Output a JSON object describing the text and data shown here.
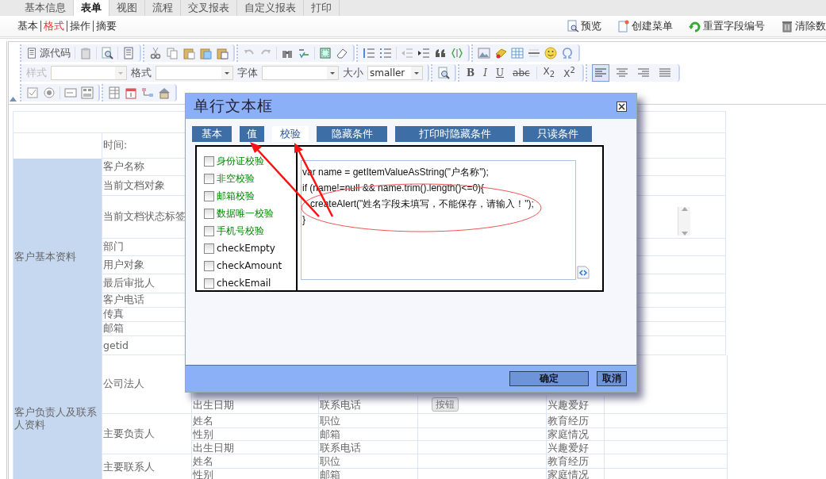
{
  "top_tabs": [
    {
      "label": "基本信息",
      "selected": false
    },
    {
      "label": "表单",
      "selected": true
    },
    {
      "label": "视图",
      "selected": false
    },
    {
      "label": "流程",
      "selected": false
    },
    {
      "label": "交叉报表",
      "selected": false
    },
    {
      "label": "自定义报表",
      "selected": false
    },
    {
      "label": "打印",
      "selected": false
    }
  ],
  "sub_tabs": [
    {
      "label": "基本",
      "selected": false
    },
    {
      "label": "格式",
      "selected": true
    },
    {
      "label": "操作",
      "selected": false
    },
    {
      "label": "摘要",
      "selected": false
    }
  ],
  "actions": [
    {
      "label": "预览"
    },
    {
      "label": "创建菜单"
    },
    {
      "label": "重置字段编号"
    },
    {
      "label": "清除数"
    }
  ],
  "editor_toolbar": {
    "source_button": "源代码",
    "dropdowns": [
      {
        "label": "样式",
        "disabled": true
      },
      {
        "label": "格式",
        "disabled": false
      },
      {
        "label": "字体",
        "disabled": false
      },
      {
        "label": "大小",
        "disabled": false,
        "value": "smaller"
      }
    ],
    "format_buttons": [
      "B",
      "I",
      "U",
      "abc",
      "X$_{2}$",
      "X$^{2}$"
    ],
    "alignments": [
      {
        "selected": true
      },
      {
        "selected": false
      },
      {
        "selected": false
      },
      {
        "selected": false
      }
    ]
  },
  "form_table": {
    "groups": [
      {
        "fields": [
          {
            "label": "时间:"
          }
        ]
      },
      {
        "label": "客户基本资料",
        "fields": [
          {
            "label": "客户名称"
          },
          {
            "label": "当前文档对象"
          },
          {
            "label": "当前文档状态标签"
          },
          {
            "label": "部门"
          },
          {
            "label": "用户对象"
          },
          {
            "label": "最后审批人"
          },
          {
            "label": "客户电话"
          },
          {
            "label": "传真"
          },
          {
            "label": "邮箱"
          },
          {
            "label": "getid"
          }
        ]
      },
      {
        "label": "客户负责人及联系人资料",
        "fields": [
          {
            "label": "公司法人",
            "subrows": [
              {
                "cells": [
                  {
                    "kind": "label",
                    "text": "出生日期"
                  },
                  {
                    "kind": "label",
                    "text": "联系电话"
                  },
                  {
                    "kind": "button",
                    "text": "按钮"
                  },
                  {
                    "kind": "label",
                    "text": "兴趣爱好"
                  }
                ]
              }
            ]
          },
          {
            "label": "主要负责人",
            "subrows": [
              {
                "cells": [
                  {
                    "kind": "label",
                    "text": "姓名"
                  },
                  {
                    "kind": "label",
                    "text": "职位"
                  },
                  {
                    "kind": "empty"
                  },
                  {
                    "kind": "label",
                    "text": "教育经历"
                  }
                ]
              },
              {
                "cells": [
                  {
                    "kind": "label",
                    "text": "性别"
                  },
                  {
                    "kind": "label",
                    "text": "邮箱"
                  },
                  {
                    "kind": "empty"
                  },
                  {
                    "kind": "label",
                    "text": "家庭情况"
                  }
                ]
              },
              {
                "cells": [
                  {
                    "kind": "label",
                    "text": "出生日期"
                  },
                  {
                    "kind": "label",
                    "text": "联系电话"
                  },
                  {
                    "kind": "empty"
                  },
                  {
                    "kind": "label",
                    "text": "兴趣爱好"
                  }
                ]
              }
            ]
          },
          {
            "label": "主要联系人",
            "subrows": [
              {
                "cells": [
                  {
                    "kind": "label",
                    "text": "姓名"
                  },
                  {
                    "kind": "label",
                    "text": "职位"
                  },
                  {
                    "kind": "empty"
                  },
                  {
                    "kind": "label",
                    "text": "教育经历"
                  }
                ]
              },
              {
                "cells": [
                  {
                    "kind": "label",
                    "text": "性别"
                  },
                  {
                    "kind": "label",
                    "text": "邮箱"
                  },
                  {
                    "kind": "empty"
                  },
                  {
                    "kind": "label",
                    "text": "家庭情况"
                  }
                ]
              }
            ]
          }
        ]
      }
    ]
  },
  "dialog": {
    "title": "单行文本框",
    "tabs": [
      {
        "label": "基本",
        "selected": false
      },
      {
        "label": "值",
        "selected": false
      },
      {
        "label": "校验",
        "selected": true
      },
      {
        "label": "隐藏条件",
        "selected": false
      },
      {
        "label": "打印时隐藏条件",
        "selected": false
      },
      {
        "label": "只读条件",
        "selected": false
      }
    ],
    "checks": [
      {
        "label": "身份证校验",
        "kind": "builtin",
        "checked": false
      },
      {
        "label": "非空校验",
        "kind": "builtin",
        "checked": false
      },
      {
        "label": "邮箱校验",
        "kind": "builtin",
        "checked": false
      },
      {
        "label": "数据唯一校验",
        "kind": "builtin",
        "checked": false
      },
      {
        "label": "手机号校验",
        "kind": "builtin",
        "checked": false
      },
      {
        "label": "checkEmpty",
        "kind": "custom",
        "checked": false
      },
      {
        "label": "checkAmount",
        "kind": "custom",
        "checked": false
      },
      {
        "label": "checkEmail",
        "kind": "custom",
        "checked": false
      }
    ],
    "script": "var name = getItemValueAsString(\"户名称\");\nif (name!=null && name.trim().length()<=0){\n   createAlert(\"姓名字段未填写，不能保存，请输入！\");\n}\n",
    "buttons": [
      "确定",
      "取消"
    ]
  }
}
